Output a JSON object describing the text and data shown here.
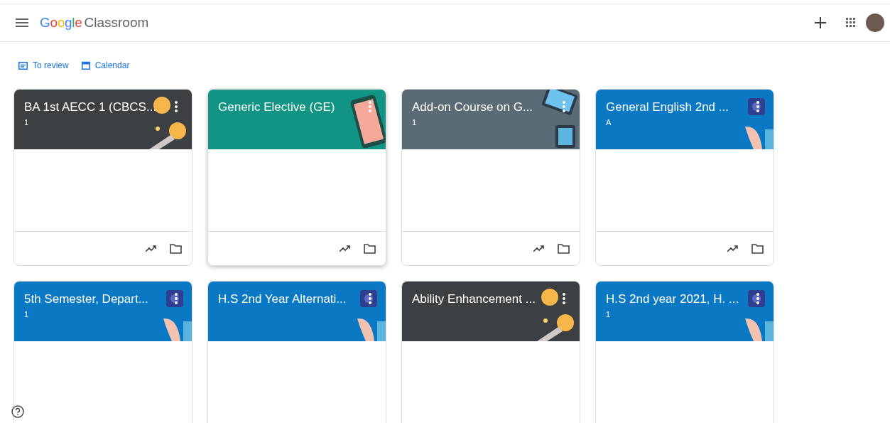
{
  "header": {
    "brand": "Google",
    "product": "Classroom"
  },
  "nav_links": [
    {
      "kind": "review",
      "label": "To review"
    },
    {
      "kind": "calendar",
      "label": "Calendar"
    }
  ],
  "courses": [
    {
      "title": "BA 1st AECC 1 (CBCS...",
      "subtitle": "1",
      "color": "#3c4043",
      "kind": "coins",
      "raised": false
    },
    {
      "title": "Generic Elective (GE)",
      "color": "#129484",
      "kind": "phone",
      "raised": true
    },
    {
      "title": "Add-on Course on G...",
      "subtitle": "1",
      "color": "#5b6b75",
      "kind": "tablet",
      "raised": false
    },
    {
      "title": "General English 2nd ...",
      "subtitle": "A",
      "color": "#0b78c4",
      "kind": "camera",
      "raised": false
    },
    {
      "title": "5th Semester, Depart...",
      "subtitle": "1",
      "color": "#0b78c4",
      "kind": "camera",
      "raised": false
    },
    {
      "title": "H.S 2nd Year Alternati...",
      "color": "#0b78c4",
      "kind": "camera",
      "raised": false
    },
    {
      "title": "Ability Enhancement ...",
      "color": "#3c4043",
      "kind": "coins",
      "raised": false
    },
    {
      "title": "H.S 2nd year 2021, H. ...",
      "subtitle": "1",
      "color": "#0b78c4",
      "kind": "camera",
      "raised": false
    }
  ]
}
